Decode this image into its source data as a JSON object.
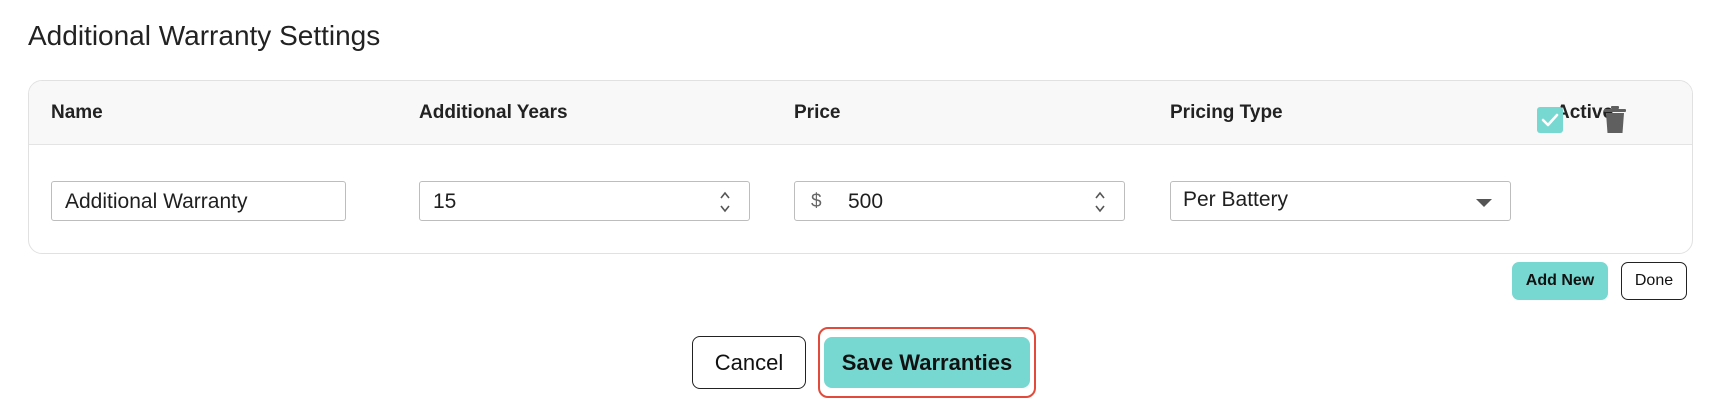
{
  "page": {
    "title": "Additional Warranty Settings"
  },
  "table": {
    "headers": {
      "name": "Name",
      "years": "Additional Years",
      "price": "Price",
      "pricing_type": "Pricing Type",
      "active": "Active"
    },
    "rows": [
      {
        "name": "Additional Warranty",
        "years": "15",
        "price_prefix": "$",
        "price": "500",
        "pricing_type": "Per Battery",
        "active": true
      }
    ]
  },
  "actions": {
    "add_new": "Add New",
    "done": "Done",
    "cancel": "Cancel",
    "save": "Save Warranties"
  },
  "colors": {
    "accent": "#76d8d1",
    "highlight_outline": "#e24b3b"
  },
  "icons": {
    "spinner": "up-down-chevron-icon",
    "dropdown": "caret-down-icon",
    "checkbox": "check-icon",
    "delete": "trash-icon"
  }
}
